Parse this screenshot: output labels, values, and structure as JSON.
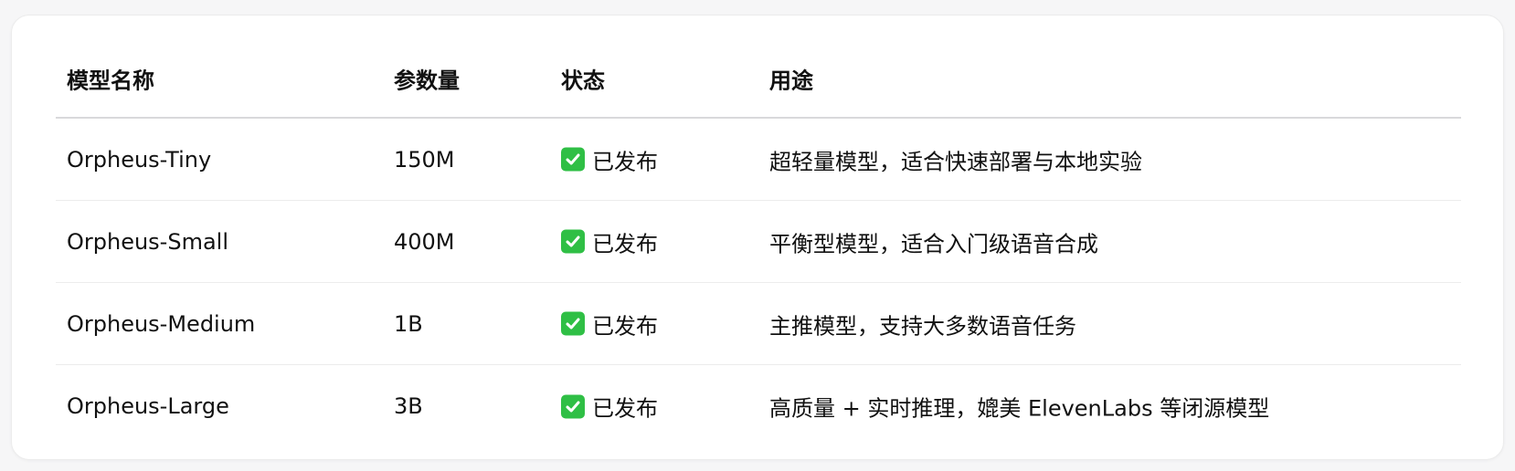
{
  "table": {
    "headers": [
      "模型名称",
      "参数量",
      "状态",
      "用途"
    ],
    "rows": [
      {
        "name": "Orpheus-Tiny",
        "params": "150M",
        "status": "已发布",
        "use": "超轻量模型，适合快速部署与本地实验"
      },
      {
        "name": "Orpheus-Small",
        "params": "400M",
        "status": "已发布",
        "use": "平衡型模型，适合入门级语音合成"
      },
      {
        "name": "Orpheus-Medium",
        "params": "1B",
        "status": "已发布",
        "use": "主推模型，支持大多数语音任务"
      },
      {
        "name": "Orpheus-Large",
        "params": "3B",
        "status": "已发布",
        "use": "高质量 + 实时推理，媲美 ElevenLabs 等闭源模型"
      }
    ]
  },
  "status_icon": "check-mark-button-icon",
  "colors": {
    "check_green": "#2fbf45",
    "text": "#111111",
    "divider": "#d9d9db"
  }
}
